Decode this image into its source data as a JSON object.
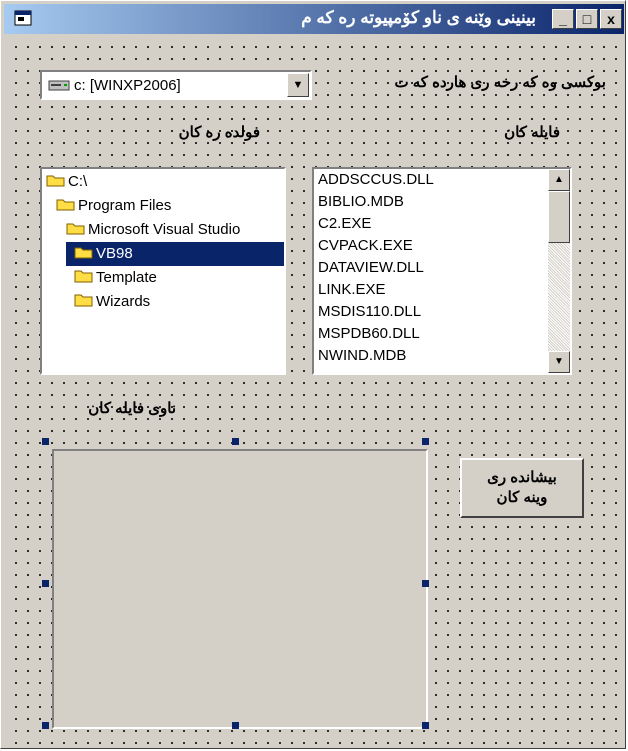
{
  "window": {
    "title": "بینینی وێنە ی ناو کۆمپیوتە رە کە م",
    "controls": [
      "x",
      "□",
      "_"
    ]
  },
  "drive_label": "بوکسی وە کە رخە ری هاردە کە ت",
  "drive_select": {
    "value": "c: [WINXP2006]"
  },
  "folders_label": "فولدە رە کان",
  "files_label": "فایلە کان",
  "folder_tree": [
    {
      "name": "C:\\"
    },
    {
      "name": "Program Files"
    },
    {
      "name": "Microsoft Visual Studio"
    },
    {
      "name": "VB98",
      "selected": true
    },
    {
      "name": "Template"
    },
    {
      "name": "Wizards"
    }
  ],
  "files": [
    "ADDSCCUS.DLL",
    "BIBLIO.MDB",
    "C2.EXE",
    "CVPACK.EXE",
    "DATAVIEW.DLL",
    "LINK.EXE",
    "MSDIS110.DLL",
    "MSPDB60.DLL",
    "NWIND.MDB"
  ],
  "file_names_label": "ناوی فایلە کان",
  "show_images_button": {
    "line1": "بیشاندە ری",
    "line2": "وینە کان"
  },
  "colors": {
    "selection": "#0a246a",
    "face": "#d4d0c8",
    "folder": "#ffdd44"
  },
  "icons": {
    "drive": "drive-icon",
    "folder": "folder-icon",
    "app": "form-icon"
  }
}
